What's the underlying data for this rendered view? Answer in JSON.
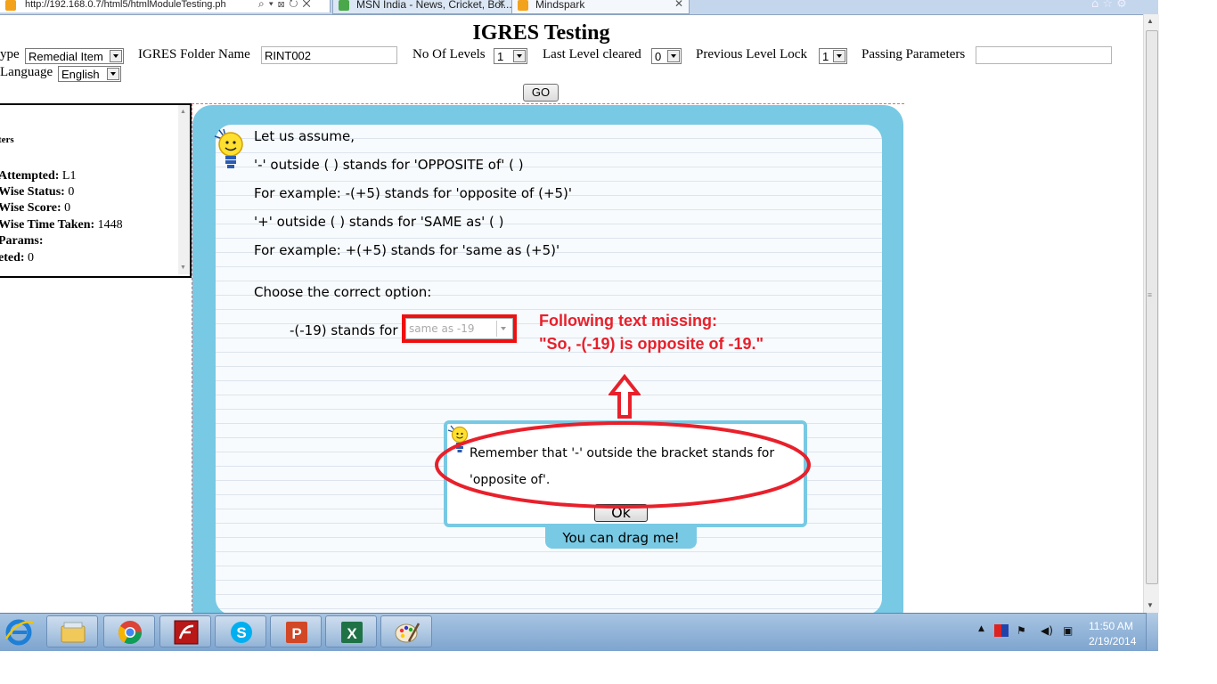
{
  "browser": {
    "address": "http://192.168.0.7/html5/htmlModuleTesting.ph",
    "tabs": [
      {
        "label": "MSN India - News, Cricket, Bol..."
      },
      {
        "label": "Mindspark"
      }
    ],
    "close_glyph": "✕",
    "window_controls": "⌂ ☆ ⚙"
  },
  "header": {
    "title": "IGRES Testing",
    "type_label": "ype",
    "type_value": "Remedial Item",
    "folder_label": "IGRES Folder Name",
    "folder_value": "RINT002",
    "levels_label": "No Of Levels",
    "levels_value": "1",
    "last_level_label": "Last Level cleared",
    "last_level_value": "0",
    "prev_lock_label": "Previous Level Lock",
    "prev_lock_value": "1",
    "passing_label": "Passing Parameters",
    "passing_value": "",
    "language_label": "Language",
    "language_value": "English",
    "go_label": "GO"
  },
  "info_panel": {
    "heading": "ters",
    "rows": [
      {
        "key": "Attempted:",
        "value": " L1"
      },
      {
        "key": "Wise Status:",
        "value": " 0"
      },
      {
        "key": "Wise Score:",
        "value": " 0"
      },
      {
        "key": "Wise Time Taken:",
        "value": " 1448"
      },
      {
        "key": "Params:",
        "value": ""
      },
      {
        "key": "eted:",
        "value": " 0"
      }
    ]
  },
  "question": {
    "lines": [
      "Let us assume,",
      "'-' outside ( ) stands for 'OPPOSITE of' ( )",
      "For example: -(+5) stands for 'opposite of (+5)'",
      "'+' outside ( ) stands for 'SAME as' ( )",
      "For example: +(+5) stands for 'same as (+5)'",
      "Choose the correct option:"
    ],
    "prompt": "-(-19) stands for",
    "answer_value": "same as -19"
  },
  "annotation": {
    "line1": "Following text missing:",
    "line2": "\"So, -(-19) is opposite of  -19.\""
  },
  "hint": {
    "line1": "Remember that '-' outside the bracket stands for",
    "line2": "'opposite of'.",
    "ok_label": "Ok",
    "drag_label": "You can drag me!"
  },
  "taskbar": {
    "apps": [
      "internet-explorer",
      "file-explorer",
      "chrome",
      "flash-player",
      "skype",
      "powerpoint",
      "excel",
      "paint"
    ],
    "time": "11:50 AM",
    "date": "2/19/2014"
  },
  "colors": {
    "frame": "#78c9e4",
    "annotation": "#e8202b",
    "taskbar": "#8fb2d8"
  }
}
